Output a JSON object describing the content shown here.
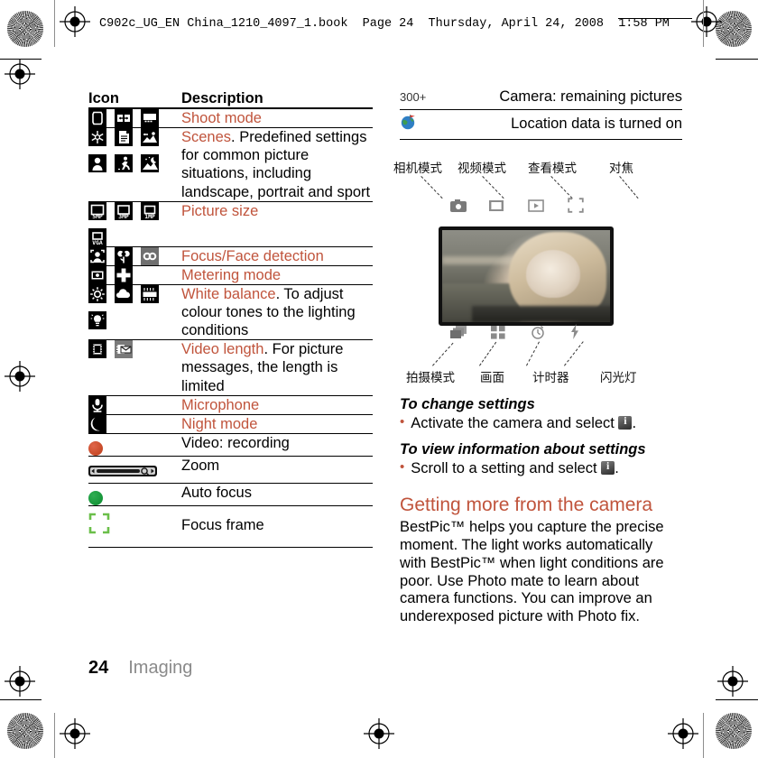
{
  "header": {
    "filename_line": "C902c_UG_EN China_1210_4097_1.book  Page 24  Thursday, April 24, 2008  1:58 PM"
  },
  "accent_color": "#c0543c",
  "icon_table": {
    "columns": [
      "Icon",
      "Description"
    ],
    "rows": [
      {
        "icons": [
          "shoot-mode-single-icon",
          "shoot-mode-panorama-icon",
          "shoot-mode-frame-icon"
        ],
        "desc_accent": "Shoot mode",
        "desc_rest": ""
      },
      {
        "icons": [
          "scenes-snow-icon",
          "scenes-document-icon",
          "scenes-landscape-icon",
          "scenes-portrait-icon",
          "scenes-sport-icon",
          "scenes-night-landscape-icon"
        ],
        "desc_accent": "Scenes",
        "desc_rest": ". Predefined settings for common picture situations, including landscape, portrait and sport"
      },
      {
        "icons": [
          "picture-size-5mp-icon",
          "picture-size-3mp-icon",
          "picture-size-1mp-icon",
          "picture-size-vga-icon"
        ],
        "desc_accent": "Picture size",
        "desc_rest": ""
      },
      {
        "icons": [
          "face-detection-icon",
          "macro-focus-icon",
          "infinity-focus-icon"
        ],
        "desc_accent": "Focus/Face detection",
        "desc_rest": ""
      },
      {
        "icons": [
          "metering-spot-icon",
          "metering-centre-icon"
        ],
        "desc_accent": "Metering mode",
        "desc_rest": ""
      },
      {
        "icons": [
          "wb-daylight-icon",
          "wb-cloudy-icon",
          "wb-fluorescent-icon",
          "wb-incandescent-icon"
        ],
        "desc_accent": "White balance",
        "desc_rest": ". To adjust colour tones to the lighting conditions"
      },
      {
        "icons": [
          "video-length-icon",
          "video-message-icon"
        ],
        "desc_accent": "Video length",
        "desc_rest": ". For picture messages, the length is limited"
      },
      {
        "icons": [
          "microphone-icon"
        ],
        "desc_accent": "Microphone",
        "desc_rest": ""
      },
      {
        "icons": [
          "night-mode-icon"
        ],
        "desc_accent": "Night mode",
        "desc_rest": ""
      },
      {
        "icons": [
          "video-recording-dot-icon"
        ],
        "desc_accent": "",
        "desc_rest": "Video: recording"
      },
      {
        "icons": [
          "zoom-slider-icon"
        ],
        "desc_accent": "",
        "desc_rest": "Zoom"
      },
      {
        "icons": [
          "auto-focus-dot-icon"
        ],
        "desc_accent": "",
        "desc_rest": "Auto focus"
      },
      {
        "icons": [
          "focus-frame-icon"
        ],
        "desc_accent": "",
        "desc_rest": "Focus frame"
      }
    ]
  },
  "status_table": {
    "rows": [
      {
        "icon_text": "300+",
        "icon_name": "remaining-pictures-icon",
        "label": "Camera: remaining pictures"
      },
      {
        "icon_text": "",
        "icon_name": "location-data-globe-icon",
        "label": "Location data is turned on"
      }
    ]
  },
  "camera_diagram": {
    "top_labels": [
      {
        "text": "相机模式",
        "name": "camera-mode-label"
      },
      {
        "text": "视频模式",
        "name": "video-mode-label"
      },
      {
        "text": "查看模式",
        "name": "view-mode-label"
      },
      {
        "text": "对焦",
        "name": "focus-label"
      }
    ],
    "bottom_labels": [
      {
        "text": "拍摄模式",
        "name": "shoot-mode-label"
      },
      {
        "text": "画面",
        "name": "scenes-label"
      },
      {
        "text": "计时器",
        "name": "self-timer-label"
      },
      {
        "text": "闪光灯",
        "name": "flash-label"
      }
    ],
    "top_icons": [
      "camera-icon",
      "video-camera-icon",
      "play-icon",
      "focus-frame-icon"
    ],
    "bottom_icons": [
      "burst-frames-icon",
      "grid-icon",
      "timer-icon",
      "flash-icon"
    ]
  },
  "instructions": [
    {
      "heading": "To change settings",
      "bullet_prefix": "Activate the camera and select ",
      "bullet_suffix": "."
    },
    {
      "heading": "To view information about settings",
      "bullet_prefix": "Scroll to a setting and select ",
      "bullet_suffix": "."
    }
  ],
  "section": {
    "title": "Getting more from the camera",
    "body": "BestPic™ helps you capture the precise moment. The light works automatically with BestPic™ when light conditions are poor. Use Photo mate to learn about camera functions. You can improve an underexposed picture with Photo fix."
  },
  "footer": {
    "page_number": "24",
    "section_name": "Imaging"
  }
}
